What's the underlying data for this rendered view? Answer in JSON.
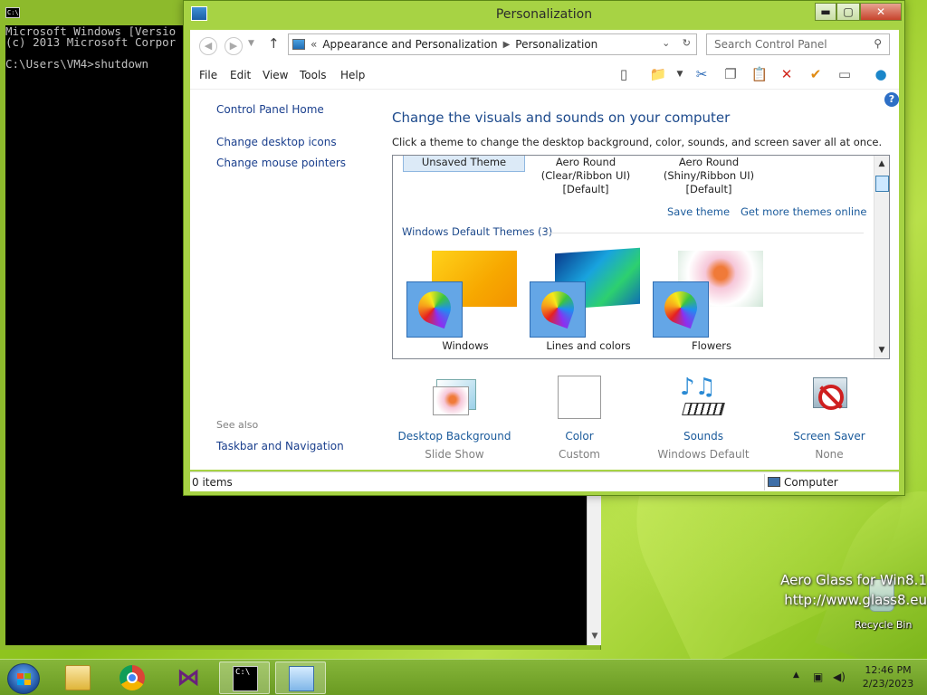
{
  "console": {
    "lines": [
      "Microsoft Windows [Versio",
      "(c) 2013 Microsoft Corpor",
      "",
      "C:\\Users\\VM4>shutdown"
    ],
    "icon_text": "C:\\"
  },
  "window": {
    "title": "Personalization",
    "controls": {
      "minimize": "▬",
      "maximize": "▢",
      "close": "✕"
    },
    "address": {
      "prefix": "«",
      "crumbs": [
        "Appearance and Personalization",
        "Personalization"
      ],
      "dropdown": "⌄",
      "refresh": "↻"
    },
    "search": {
      "placeholder": "Search Control Panel",
      "icon": "search-icon"
    },
    "menu": [
      "File",
      "Edit",
      "View",
      "Tools",
      "Help"
    ],
    "sidebar": {
      "links": [
        "Control Panel Home",
        "Change desktop icons",
        "Change mouse pointers"
      ],
      "see_also_label": "See also",
      "see_also_links": [
        "Taskbar and Navigation"
      ]
    },
    "heading": "Change the visuals and sounds on your computer",
    "subheading": "Click a theme to change the desktop background, color, sounds, and screen saver all at once.",
    "top_themes": [
      {
        "label": "Unsaved Theme"
      },
      {
        "label": "Aero Round\n(Clear/Ribbon UI)\n[Default]"
      },
      {
        "label": "Aero Round\n(Shiny/Ribbon UI)\n[Default]"
      }
    ],
    "save_theme": "Save theme",
    "get_more": "Get more themes online",
    "group_label": "Windows Default Themes (3)",
    "themes": [
      {
        "name": "Windows",
        "color": "#f7b500"
      },
      {
        "name": "Lines and colors",
        "color": "#1aa0d8"
      },
      {
        "name": "Flowers",
        "color": "#f2a9c4"
      }
    ],
    "bottom": [
      {
        "name": "Desktop Background",
        "sub": "Slide Show"
      },
      {
        "name": "Color",
        "sub": "Custom"
      },
      {
        "name": "Sounds",
        "sub": "Windows Default"
      },
      {
        "name": "Screen Saver",
        "sub": "None"
      }
    ],
    "status": {
      "items": "0 items",
      "location": "Computer"
    },
    "help": "?"
  },
  "desktop": {
    "watermark": [
      "Aero Glass for Win8.1",
      "http://www.glass8.eu"
    ],
    "recycle_bin": "Recycle Bin"
  },
  "taskbar": {
    "time": "12:46 PM",
    "date": "2/23/2023",
    "tray_icons": [
      "show-hidden-icon",
      "network-icon",
      "volume-icon"
    ]
  },
  "colors": {
    "accent": "#1d4a8c",
    "link": "#1a5a9b",
    "glass": "#a7d344"
  }
}
